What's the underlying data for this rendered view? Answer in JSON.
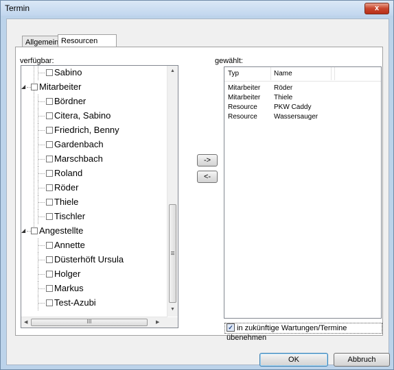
{
  "window": {
    "title": "Termin",
    "close_label": "x"
  },
  "tabs": [
    {
      "label": "Allgemein"
    },
    {
      "label": "Resourcen"
    }
  ],
  "available": {
    "label": "verfügbar:",
    "tree": [
      {
        "label": "Sabino",
        "level": 2
      },
      {
        "label": "Mitarbeiter",
        "level": 1,
        "expanded": true
      },
      {
        "label": "Bördner",
        "level": 2
      },
      {
        "label": "Citera, Sabino",
        "level": 2
      },
      {
        "label": "Friedrich, Benny",
        "level": 2
      },
      {
        "label": "Gardenbach",
        "level": 2
      },
      {
        "label": "Marschbach",
        "level": 2
      },
      {
        "label": "Roland",
        "level": 2
      },
      {
        "label": "Röder",
        "level": 2
      },
      {
        "label": "Thiele",
        "level": 2
      },
      {
        "label": "Tischler",
        "level": 2
      },
      {
        "label": "Angestellte",
        "level": 1,
        "expanded": true
      },
      {
        "label": "Annette",
        "level": 2
      },
      {
        "label": "Düsterhöft Ursula",
        "level": 2
      },
      {
        "label": "Holger",
        "level": 2
      },
      {
        "label": "Markus",
        "level": 2
      },
      {
        "label": "Test-Azubi",
        "level": 2
      }
    ]
  },
  "transfer": {
    "add_label": "->",
    "remove_label": "<-"
  },
  "selected": {
    "label": "gewählt:",
    "columns": [
      "Typ",
      "Name"
    ],
    "rows": [
      {
        "typ": "Mitarbeiter",
        "name": "Röder"
      },
      {
        "typ": "Mitarbeiter",
        "name": "Thiele"
      },
      {
        "typ": "Resource",
        "name": "PKW Caddy"
      },
      {
        "typ": "Resource",
        "name": "Wassersauger"
      }
    ]
  },
  "apply_future": {
    "label": "in zukünftige Wartungen/Termine übenehmen",
    "checked": true
  },
  "footer": {
    "ok_label": "OK",
    "cancel_label": "Abbruch"
  }
}
